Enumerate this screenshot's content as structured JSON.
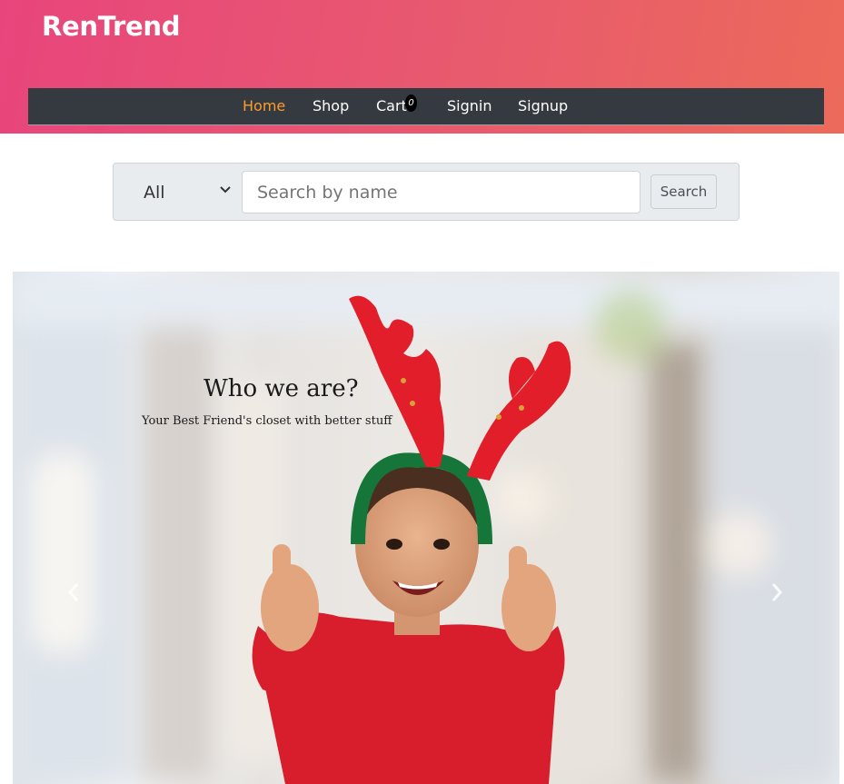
{
  "brand": {
    "name": "RenTrend"
  },
  "nav": {
    "items": [
      {
        "label": "Home",
        "active": true
      },
      {
        "label": "Shop"
      },
      {
        "label": "Cart"
      },
      {
        "label": "Signin"
      },
      {
        "label": "Signup"
      }
    ],
    "cart_count": "0"
  },
  "search": {
    "category": "All",
    "placeholder": "Search by name",
    "button_label": "Search"
  },
  "carousel": {
    "title": "Who we are?",
    "subtitle": "Your Best Friend's closet with better stuff",
    "prev_icon": "chevron-left-icon",
    "next_icon": "chevron-right-icon"
  },
  "colors": {
    "header_gradient_start": "#e8457c",
    "header_gradient_end": "#ec6a5a",
    "navbar_bg": "#343a40",
    "nav_active": "#fd9c2c"
  }
}
